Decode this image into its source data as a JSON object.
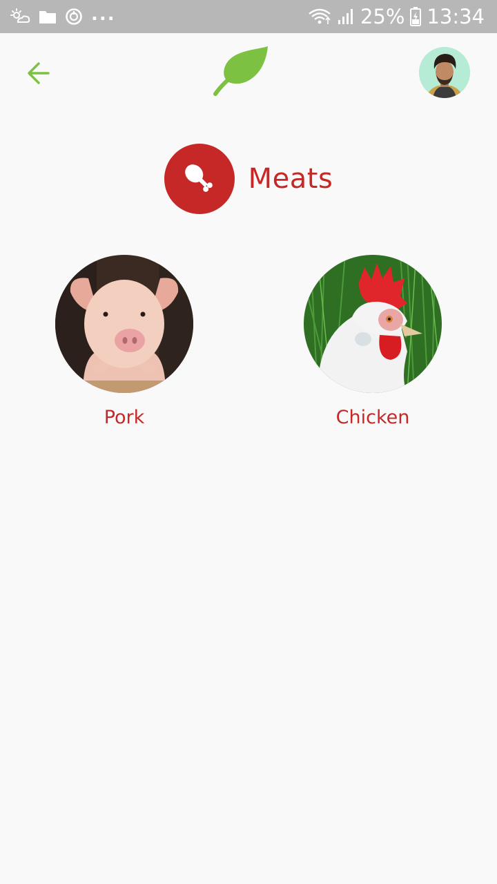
{
  "status_bar": {
    "battery": "25%",
    "time": "13:34",
    "overflow": "...",
    "icons": [
      "weather-icon",
      "folder-icon",
      "sync-icon",
      "wifi-icon",
      "signal-icon",
      "battery-icon"
    ]
  },
  "app_bar": {
    "icons": [
      "back-arrow-icon",
      "leaf-logo-icon",
      "avatar"
    ]
  },
  "category": {
    "title": "Meats",
    "icon": "drumstick-icon",
    "color": "#c62828"
  },
  "items": [
    {
      "label": "Pork"
    },
    {
      "label": "Chicken"
    }
  ],
  "colors": {
    "accent": "#7cc142",
    "category_red": "#c62828",
    "background": "#f9f9f9",
    "status_bar": "#b7b7b7"
  }
}
